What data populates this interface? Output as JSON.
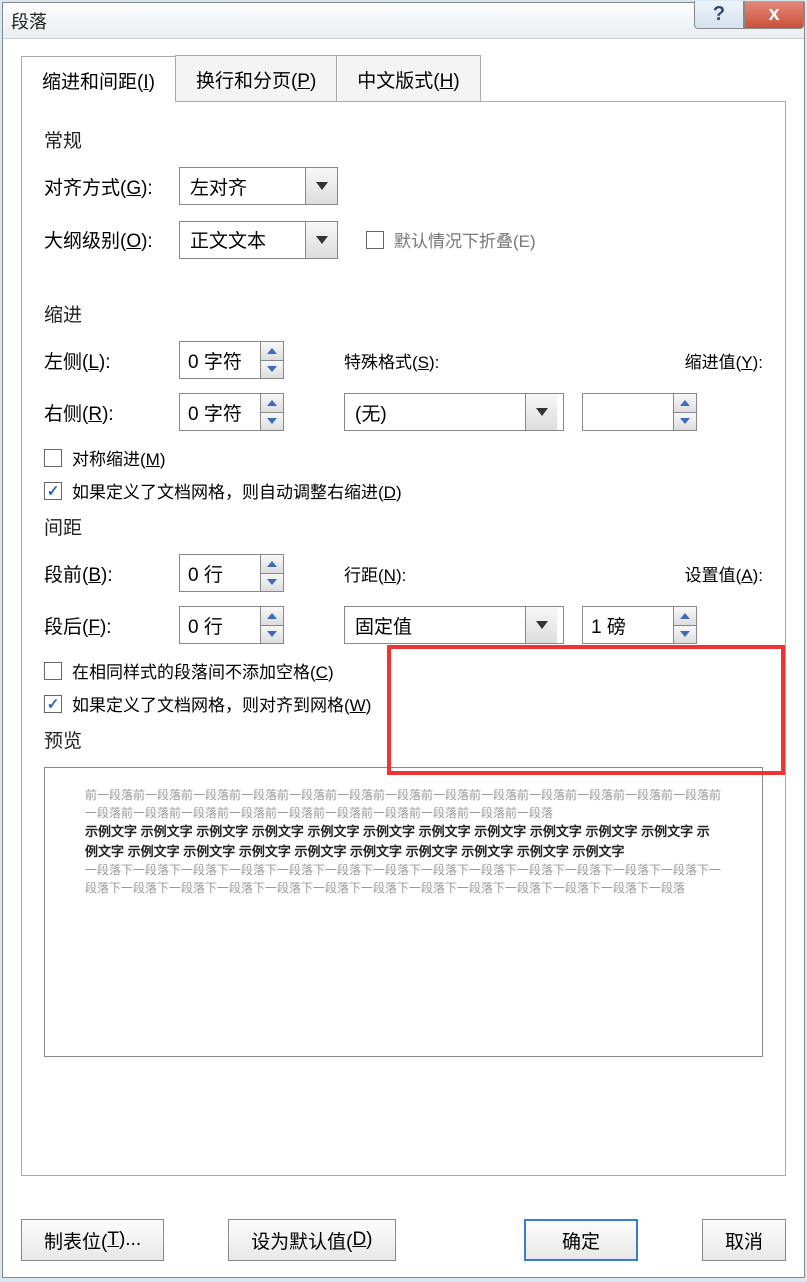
{
  "title": "段落",
  "tabs": {
    "indent": "缩进和间距(I)",
    "pagebreak": "换行和分页(P)",
    "cjk": "中文版式(H)"
  },
  "general": {
    "header": "常规",
    "alignment_label": "对齐方式(G):",
    "alignment_value": "左对齐",
    "outline_label": "大纲级别(O):",
    "outline_value": "正文文本",
    "collapse_label": "默认情况下折叠(E)"
  },
  "indent": {
    "header": "缩进",
    "left_label": "左侧(L):",
    "left_value": "0 字符",
    "right_label": "右侧(R):",
    "right_value": "0 字符",
    "special_label": "特殊格式(S):",
    "special_value": "(无)",
    "by_label": "缩进值(Y):",
    "by_value": "",
    "mirror_label": "对称缩进(M)",
    "autogrid_label": "如果定义了文档网格，则自动调整右缩进(D)"
  },
  "spacing": {
    "header": "间距",
    "before_label": "段前(B):",
    "before_value": "0 行",
    "after_label": "段后(F):",
    "after_value": "0 行",
    "linespace_label": "行距(N):",
    "linespace_value": "固定值",
    "at_label": "设置值(A):",
    "at_value": "1 磅",
    "nosamestyle_label": "在相同样式的段落间不添加空格(C)",
    "snapgrid_label": "如果定义了文档网格，则对齐到网格(W)"
  },
  "preview": {
    "header": "预览",
    "before": "前一段落前一段落前一段落前一段落前一段落前一段落前一段落前一段落前一段落前一段落前一段落前一段落前一段落前一段落前一段落前一段落前一段落前一段落前一段落前一段落前一段落前一段落前一段落",
    "sample": "示例文字 示例文字 示例文字 示例文字 示例文字 示例文字 示例文字 示例文字 示例文字 示例文字 示例文字 示例文字 示例文字 示例文字 示例文字 示例文字 示例文字 示例文字 示例文字 示例文字 示例文字",
    "after": "一段落下一段落下一段落下一段落下一段落下一段落下一段落下一段落下一段落下一段落下一段落下一段落下一段落下一段落下一段落下一段落下一段落下一段落下一段落下一段落下一段落下一段落下一段落下一段落下一段落下一段落"
  },
  "buttons": {
    "tabs": "制表位(T)...",
    "default": "设为默认值(D)",
    "ok": "确定",
    "cancel": "取消"
  }
}
